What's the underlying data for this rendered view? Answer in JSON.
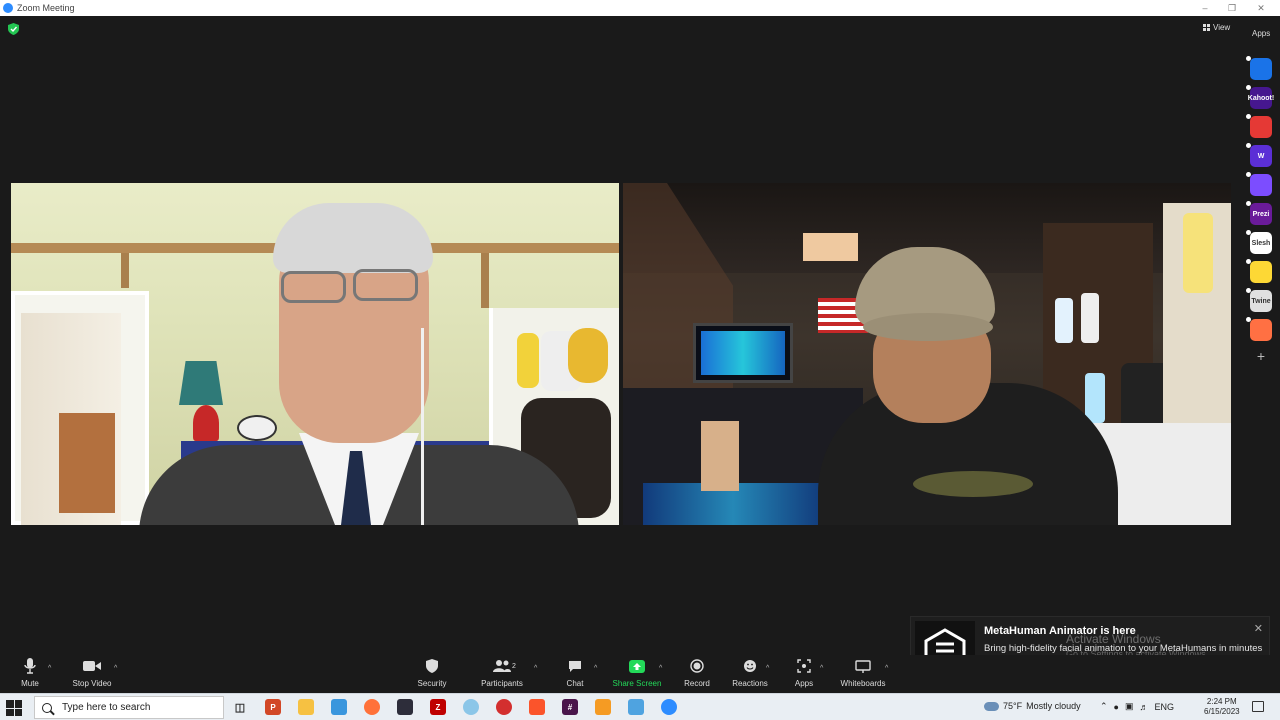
{
  "window": {
    "title": "Zoom Meeting"
  },
  "top": {
    "view_label": "View",
    "apps_label": "Apps"
  },
  "apps_rail": [
    {
      "name": "app-icon-1",
      "color": "#1a73e8",
      "text": ""
    },
    {
      "name": "app-icon-kahoot",
      "color": "#46178f",
      "text": "Kahoot!"
    },
    {
      "name": "app-icon-3",
      "color": "#e53935",
      "text": ""
    },
    {
      "name": "app-icon-wordly",
      "color": "#5b2fd6",
      "text": "W"
    },
    {
      "name": "app-icon-5",
      "color": "#7c4dff",
      "text": ""
    },
    {
      "name": "app-icon-prezi",
      "color": "#6a1b9a",
      "text": "Prezi"
    },
    {
      "name": "app-icon-slido",
      "color": "#ffffff",
      "text": "Slesh"
    },
    {
      "name": "app-icon-8",
      "color": "#fdd835",
      "text": ""
    },
    {
      "name": "app-icon-9",
      "color": "#e0e0e0",
      "text": "Twine"
    },
    {
      "name": "app-icon-10",
      "color": "#ff7043",
      "text": ""
    }
  ],
  "toolbar": {
    "mute": "Mute",
    "stop_video": "Stop Video",
    "security": "Security",
    "participants": "Participants",
    "participants_count": "2",
    "chat": "Chat",
    "share_screen": "Share Screen",
    "record": "Record",
    "reactions": "Reactions",
    "apps": "Apps",
    "whiteboards": "Whiteboards"
  },
  "notification": {
    "title": "MetaHuman Animator is here",
    "body": "Bring high-fidelity facial animation to your MetaHumans in minutes using just an iPhone and a PC. Get MetaHuman Animator now!",
    "watermark_title": "Activate Windows",
    "watermark_sub": "Go to Settings to activate Windows."
  },
  "taskbar": {
    "search_placeholder": "Type here to search",
    "weather_temp": "75°F",
    "weather_desc": "Mostly cloudy",
    "lang": "ENG",
    "time": "2:24 PM",
    "date": "6/15/2023"
  },
  "colors": {
    "zoom_blue": "#2d8cff",
    "share_green": "#23d959",
    "toolbar_bg": "#1a1a1a"
  }
}
